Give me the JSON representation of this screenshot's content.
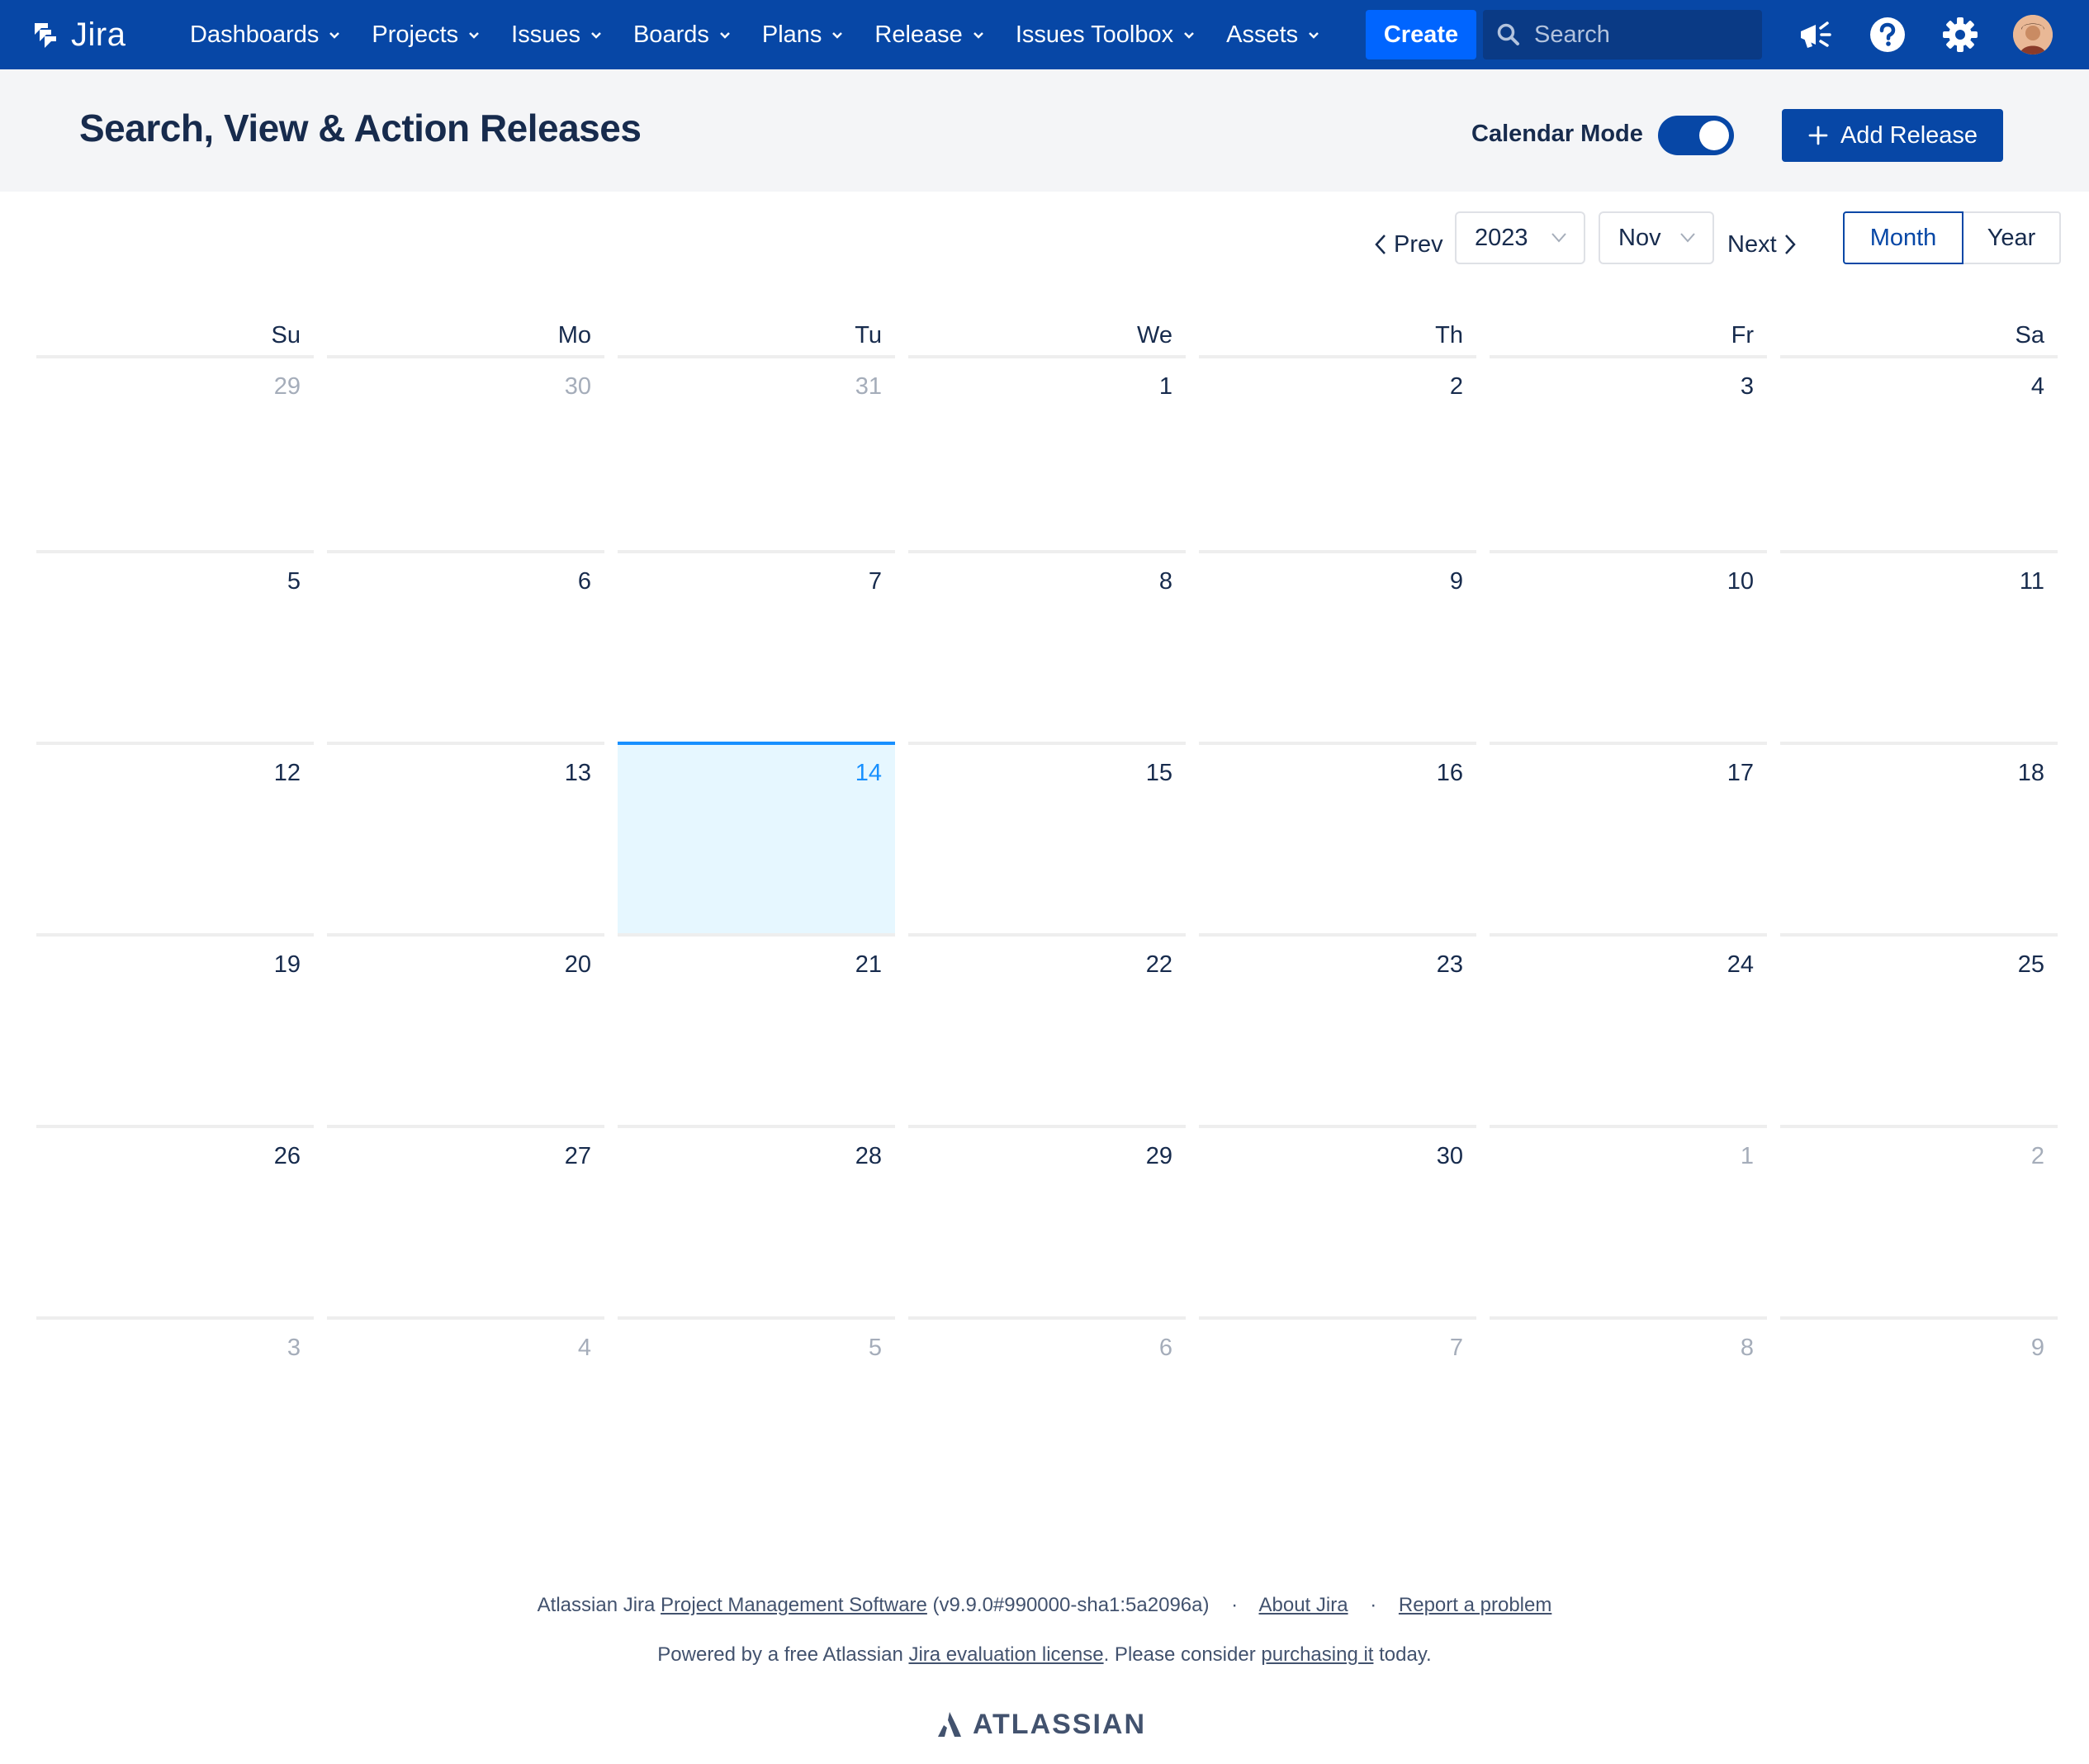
{
  "app": {
    "name": "Jira"
  },
  "nav": {
    "items": [
      {
        "label": "Dashboards"
      },
      {
        "label": "Projects"
      },
      {
        "label": "Issues"
      },
      {
        "label": "Boards"
      },
      {
        "label": "Plans"
      },
      {
        "label": "Release"
      },
      {
        "label": "Issues Toolbox"
      },
      {
        "label": "Assets"
      }
    ],
    "create_label": "Create",
    "search_placeholder": "Search"
  },
  "header": {
    "title": "Search, View & Action Releases",
    "calendar_mode_label": "Calendar Mode",
    "calendar_mode_on": true,
    "add_release_label": "Add Release"
  },
  "calendar": {
    "prev_label": "Prev",
    "next_label": "Next",
    "year": "2023",
    "month": "Nov",
    "view_month_label": "Month",
    "view_year_label": "Year",
    "selected_view": "Month",
    "weekdays": [
      "Su",
      "Mo",
      "Tu",
      "We",
      "Th",
      "Fr",
      "Sa"
    ],
    "today": "14",
    "weeks": [
      [
        {
          "d": "29",
          "other": true
        },
        {
          "d": "30",
          "other": true
        },
        {
          "d": "31",
          "other": true
        },
        {
          "d": "1"
        },
        {
          "d": "2"
        },
        {
          "d": "3"
        },
        {
          "d": "4"
        }
      ],
      [
        {
          "d": "5"
        },
        {
          "d": "6"
        },
        {
          "d": "7"
        },
        {
          "d": "8"
        },
        {
          "d": "9"
        },
        {
          "d": "10"
        },
        {
          "d": "11"
        }
      ],
      [
        {
          "d": "12"
        },
        {
          "d": "13"
        },
        {
          "d": "14",
          "today": true
        },
        {
          "d": "15"
        },
        {
          "d": "16"
        },
        {
          "d": "17"
        },
        {
          "d": "18"
        }
      ],
      [
        {
          "d": "19"
        },
        {
          "d": "20"
        },
        {
          "d": "21"
        },
        {
          "d": "22"
        },
        {
          "d": "23"
        },
        {
          "d": "24"
        },
        {
          "d": "25"
        }
      ],
      [
        {
          "d": "26"
        },
        {
          "d": "27"
        },
        {
          "d": "28"
        },
        {
          "d": "29"
        },
        {
          "d": "30"
        },
        {
          "d": "1",
          "other": true
        },
        {
          "d": "2",
          "other": true
        }
      ],
      [
        {
          "d": "3",
          "other": true
        },
        {
          "d": "4",
          "other": true
        },
        {
          "d": "5",
          "other": true
        },
        {
          "d": "6",
          "other": true
        },
        {
          "d": "7",
          "other": true
        },
        {
          "d": "8",
          "other": true
        },
        {
          "d": "9",
          "other": true
        }
      ]
    ]
  },
  "footer": {
    "line1_prefix": "Atlassian Jira ",
    "line1_link": "Project Management Software",
    "line1_version": " (v9.9.0#990000-sha1:5a2096a)",
    "about_link": "About Jira",
    "report_link": "Report a problem",
    "separator": "·",
    "line2_prefix": "Powered by a free Atlassian ",
    "line2_link1": "Jira evaluation license",
    "line2_mid": ". Please consider ",
    "line2_link2": "purchasing it",
    "line2_suffix": " today.",
    "logo_text": "ATLASSIAN"
  },
  "colors": {
    "nav_bg": "#0747a6",
    "create_bg": "#0065ff",
    "today_bg": "#e6f7ff",
    "today_accent": "#1890ff"
  }
}
